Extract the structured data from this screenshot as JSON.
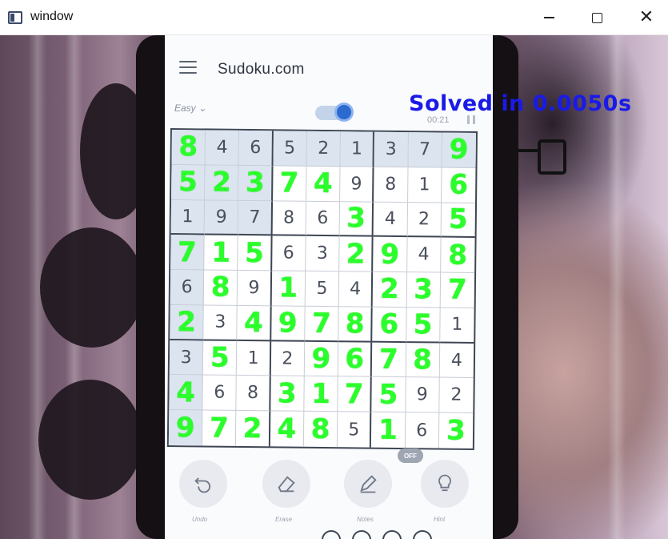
{
  "window": {
    "title": "window",
    "icon": "app-window-icon",
    "controls": {
      "minimize": "minimize-icon",
      "maximize": "maximize-icon",
      "close": "close-icon"
    }
  },
  "overlay": {
    "solve_text": "Solved in 0.0050s",
    "color": "#1a1ae8"
  },
  "phone_app": {
    "brand": "Sudoku.com",
    "difficulty": "Easy",
    "timer": "00:21",
    "toggle_on": true,
    "accent_color": "#2b6bd0"
  },
  "sudoku": {
    "rows": [
      [
        "8",
        "4",
        "6",
        "5",
        "2",
        "1",
        "3",
        "7",
        "9"
      ],
      [
        "5",
        "2",
        "3",
        "7",
        "4",
        "9",
        "8",
        "1",
        "6"
      ],
      [
        "1",
        "9",
        "7",
        "8",
        "6",
        "3",
        "4",
        "2",
        "5"
      ],
      [
        "7",
        "1",
        "5",
        "6",
        "3",
        "2",
        "9",
        "4",
        "8"
      ],
      [
        "6",
        "8",
        "9",
        "1",
        "5",
        "4",
        "2",
        "3",
        "7"
      ],
      [
        "2",
        "3",
        "4",
        "9",
        "7",
        "8",
        "6",
        "5",
        "1"
      ],
      [
        "3",
        "5",
        "1",
        "2",
        "9",
        "6",
        "7",
        "8",
        "4"
      ],
      [
        "4",
        "6",
        "8",
        "3",
        "1",
        "7",
        "5",
        "9",
        "2"
      ],
      [
        "9",
        "7",
        "2",
        "4",
        "8",
        "5",
        "1",
        "6",
        "3"
      ]
    ],
    "solved_mask": [
      [
        1,
        0,
        0,
        0,
        0,
        0,
        0,
        0,
        1
      ],
      [
        1,
        1,
        1,
        1,
        1,
        0,
        0,
        0,
        1
      ],
      [
        0,
        0,
        0,
        0,
        0,
        1,
        0,
        0,
        1
      ],
      [
        1,
        1,
        1,
        0,
        0,
        1,
        1,
        0,
        1
      ],
      [
        0,
        1,
        0,
        1,
        0,
        0,
        1,
        1,
        1
      ],
      [
        1,
        0,
        1,
        1,
        1,
        1,
        1,
        1,
        0
      ],
      [
        0,
        1,
        0,
        0,
        1,
        1,
        1,
        1,
        0
      ],
      [
        1,
        0,
        0,
        1,
        1,
        1,
        1,
        0,
        0
      ],
      [
        1,
        1,
        1,
        1,
        1,
        0,
        1,
        0,
        1
      ]
    ],
    "solved_color": "#2bff2b",
    "given_color": "#4a4f5c"
  },
  "toolbar": {
    "undo": {
      "label": "Undo",
      "icon": "undo-icon"
    },
    "erase": {
      "label": "Erase",
      "icon": "eraser-icon"
    },
    "notes": {
      "label": "Notes",
      "icon": "pencil-icon",
      "badge": "OFF"
    },
    "hint": {
      "label": "Hint",
      "icon": "lightbulb-icon"
    }
  }
}
